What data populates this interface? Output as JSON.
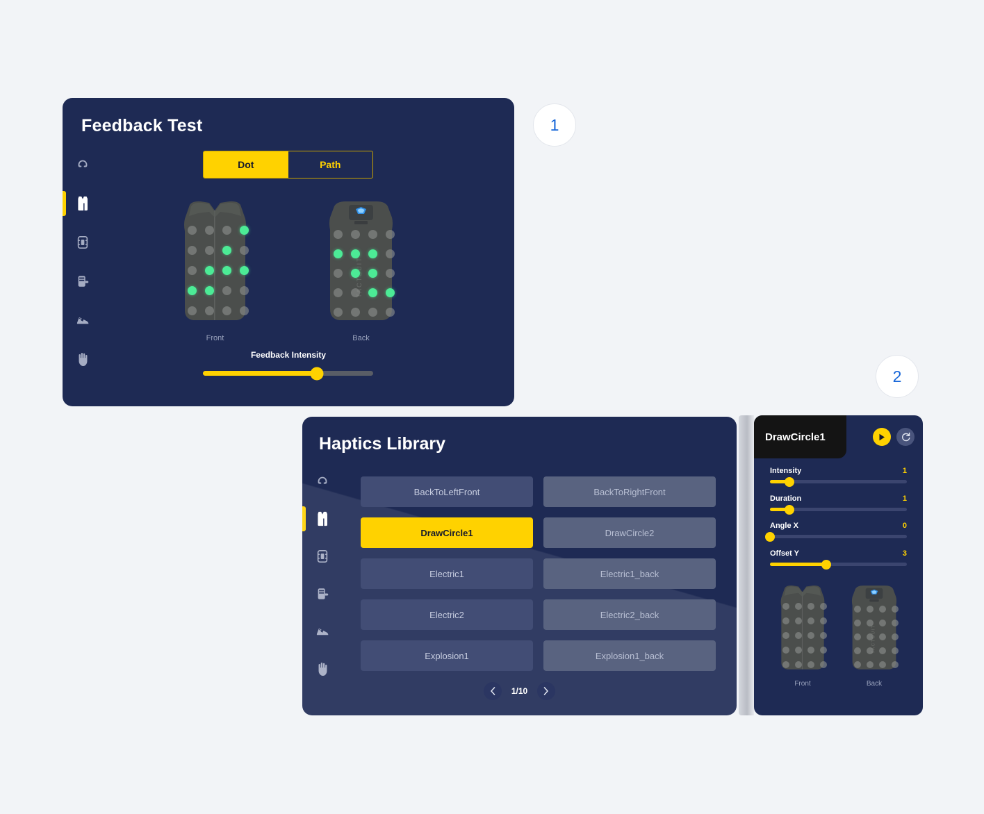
{
  "badges": [
    {
      "label": "1"
    },
    {
      "label": "2"
    }
  ],
  "colors": {
    "panel_bg": "#1e2a54",
    "accent_yellow": "#ffd200",
    "active_dot_green": "#4ceb96",
    "badge_blue": "#1565d8",
    "page_bg": "#f2f4f7"
  },
  "sidebar": {
    "items": [
      {
        "name": "headband",
        "icon": "headband-icon",
        "active": false
      },
      {
        "name": "vest",
        "icon": "vest-icon",
        "active": true
      },
      {
        "name": "forearm",
        "icon": "forearm-icon",
        "active": false
      },
      {
        "name": "sleeve",
        "icon": "sleeve-icon",
        "active": false
      },
      {
        "name": "shoes",
        "icon": "shoes-icon",
        "active": false
      },
      {
        "name": "glove",
        "icon": "glove-icon",
        "active": false
      }
    ]
  },
  "feedback_test": {
    "title": "Feedback Test",
    "modes": [
      {
        "label": "Dot",
        "active": true
      },
      {
        "label": "Path",
        "active": false
      }
    ],
    "front_caption": "Front",
    "back_caption": "Back",
    "intensity_label": "Feedback Intensity",
    "intensity_percent": 67,
    "front_dots_on": [
      [
        0,
        3
      ],
      [
        1,
        2
      ],
      [
        2,
        1
      ],
      [
        2,
        2
      ],
      [
        2,
        3
      ],
      [
        3,
        0
      ],
      [
        3,
        1
      ]
    ],
    "back_dots_on": [
      [
        1,
        0
      ],
      [
        1,
        1
      ],
      [
        1,
        2
      ],
      [
        2,
        1
      ],
      [
        2,
        2
      ],
      [
        3,
        2
      ],
      [
        3,
        3
      ]
    ],
    "grid_rows": 5,
    "grid_cols": 4
  },
  "haptics_library": {
    "title": "Haptics Library",
    "items": [
      {
        "label": "BackToLeftFront",
        "state": "normal"
      },
      {
        "label": "BackToRightFront",
        "state": "dim"
      },
      {
        "label": "DrawCircle1",
        "state": "selected"
      },
      {
        "label": "DrawCircle2",
        "state": "dim"
      },
      {
        "label": "Electric1",
        "state": "normal"
      },
      {
        "label": "Electric1_back",
        "state": "dim"
      },
      {
        "label": "Electric2",
        "state": "normal"
      },
      {
        "label": "Electric2_back",
        "state": "dim"
      },
      {
        "label": "Explosion1",
        "state": "normal"
      },
      {
        "label": "Explosion1_back",
        "state": "dim"
      }
    ],
    "pager": {
      "prev_icon": "chevron-left-icon",
      "next_icon": "chevron-right-icon",
      "page_text": "1/10"
    }
  },
  "detail_panel": {
    "title": "DrawCircle1",
    "play_icon": "play-icon",
    "reset_icon": "reset-icon",
    "params": [
      {
        "name": "Intensity",
        "value": "1",
        "percent": 14
      },
      {
        "name": "Duration",
        "value": "1",
        "percent": 14
      },
      {
        "name": "Angle X",
        "value": "0",
        "percent": 0
      },
      {
        "name": "Offset Y",
        "value": "3",
        "percent": 41
      }
    ],
    "front_caption": "Front",
    "back_caption": "Back",
    "preview_dots_on": []
  }
}
